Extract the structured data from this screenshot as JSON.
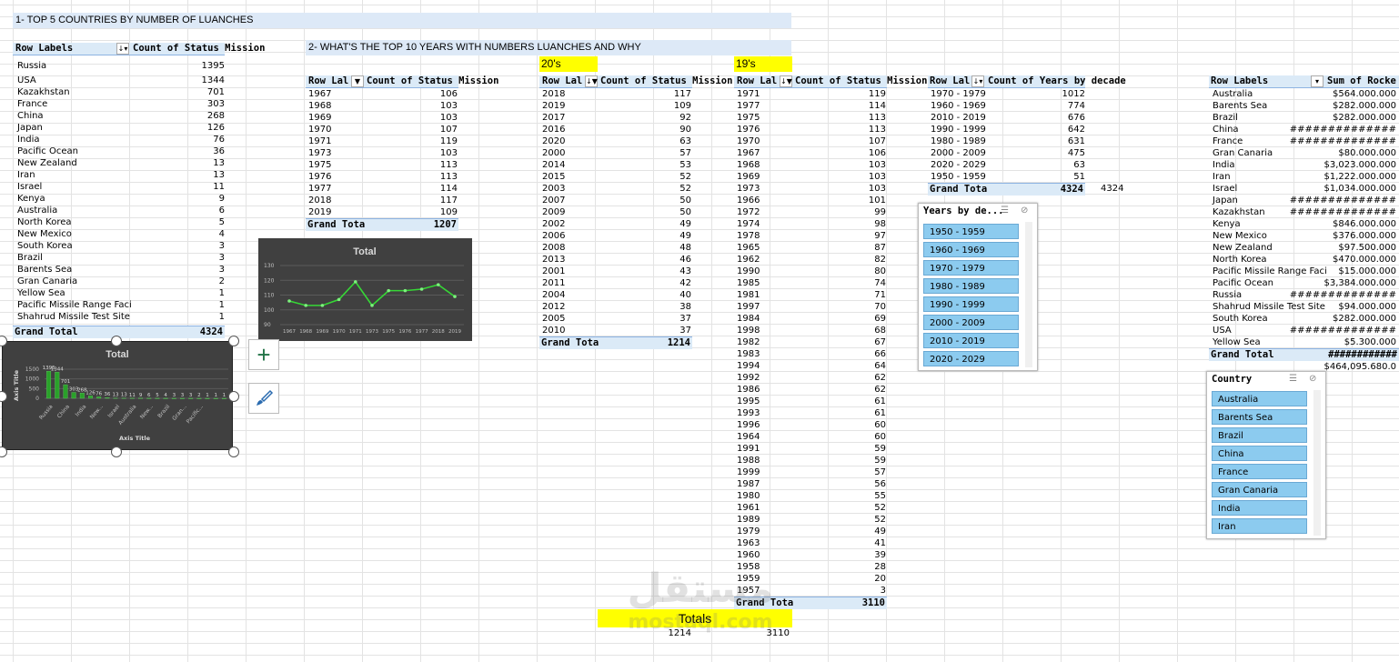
{
  "section1_title": "1- TOP 5 COUNTRIES BY NUMBER OF LUANCHES",
  "section2_title": "2- WHAT'S THE TOP 10 YEARS WITH NUMBERS LUANCHES AND WHY",
  "pt_countries": {
    "h1": "Row Labels",
    "h2": "Count of Status Mission",
    "rows": [
      [
        "Russia",
        "1395"
      ],
      [
        "USA",
        "1344"
      ],
      [
        "Kazakhstan",
        "701"
      ],
      [
        "France",
        "303"
      ],
      [
        "China",
        "268"
      ],
      [
        "Japan",
        "126"
      ],
      [
        "India",
        "76"
      ],
      [
        "Pacific Ocean",
        "36"
      ],
      [
        "New Zealand",
        "13"
      ],
      [
        "Iran",
        "13"
      ],
      [
        "Israel",
        "11"
      ],
      [
        "Kenya",
        "9"
      ],
      [
        "Australia",
        "6"
      ],
      [
        "North Korea",
        "5"
      ],
      [
        "New Mexico",
        "4"
      ],
      [
        "South Korea",
        "3"
      ],
      [
        "Brazil",
        "3"
      ],
      [
        "Barents Sea",
        "3"
      ],
      [
        "Gran Canaria",
        "2"
      ],
      [
        "Yellow Sea",
        "1"
      ],
      [
        "Pacific Missile Range Faci",
        "1"
      ],
      [
        "Shahrud Missile Test Site",
        "1"
      ]
    ],
    "total_label": "Grand Total",
    "total": "4324"
  },
  "pt_years10": {
    "h1": "Row Lal",
    "h2": "Count of Status Mission",
    "rows": [
      [
        "1967",
        "106"
      ],
      [
        "1968",
        "103"
      ],
      [
        "1969",
        "103"
      ],
      [
        "1970",
        "107"
      ],
      [
        "1971",
        "119"
      ],
      [
        "1973",
        "103"
      ],
      [
        "1975",
        "113"
      ],
      [
        "1976",
        "113"
      ],
      [
        "1977",
        "114"
      ],
      [
        "2018",
        "117"
      ],
      [
        "2019",
        "109"
      ]
    ],
    "total_label": "Grand Tota",
    "total": "1207"
  },
  "label_20s": "20's",
  "label_19s": "19's",
  "pt_20s": {
    "h1": "Row Lal",
    "h2": "Count of Status Mission",
    "rows": [
      [
        "2018",
        "117"
      ],
      [
        "2019",
        "109"
      ],
      [
        "2017",
        "92"
      ],
      [
        "2016",
        "90"
      ],
      [
        "2020",
        "63"
      ],
      [
        "2000",
        "57"
      ],
      [
        "2014",
        "53"
      ],
      [
        "2015",
        "52"
      ],
      [
        "2003",
        "52"
      ],
      [
        "2007",
        "50"
      ],
      [
        "2009",
        "50"
      ],
      [
        "2002",
        "49"
      ],
      [
        "2006",
        "49"
      ],
      [
        "2008",
        "48"
      ],
      [
        "2013",
        "46"
      ],
      [
        "2001",
        "43"
      ],
      [
        "2011",
        "42"
      ],
      [
        "2004",
        "40"
      ],
      [
        "2012",
        "38"
      ],
      [
        "2005",
        "37"
      ],
      [
        "2010",
        "37"
      ]
    ],
    "total_label": "Grand Tota",
    "total": "1214"
  },
  "pt_19s": {
    "h1": "Row Lal",
    "h2": "Count of Status Mission",
    "rows": [
      [
        "1971",
        "119"
      ],
      [
        "1977",
        "114"
      ],
      [
        "1975",
        "113"
      ],
      [
        "1976",
        "113"
      ],
      [
        "1970",
        "107"
      ],
      [
        "1967",
        "106"
      ],
      [
        "1968",
        "103"
      ],
      [
        "1969",
        "103"
      ],
      [
        "1973",
        "103"
      ],
      [
        "1966",
        "101"
      ],
      [
        "1972",
        "99"
      ],
      [
        "1974",
        "98"
      ],
      [
        "1978",
        "97"
      ],
      [
        "1965",
        "87"
      ],
      [
        "1962",
        "82"
      ],
      [
        "1990",
        "80"
      ],
      [
        "1985",
        "74"
      ],
      [
        "1981",
        "71"
      ],
      [
        "1997",
        "70"
      ],
      [
        "1984",
        "69"
      ],
      [
        "1998",
        "68"
      ],
      [
        "1982",
        "67"
      ],
      [
        "1983",
        "66"
      ],
      [
        "1994",
        "64"
      ],
      [
        "1992",
        "62"
      ],
      [
        "1986",
        "62"
      ],
      [
        "1995",
        "61"
      ],
      [
        "1993",
        "61"
      ],
      [
        "1996",
        "60"
      ],
      [
        "1964",
        "60"
      ],
      [
        "1991",
        "59"
      ],
      [
        "1988",
        "59"
      ],
      [
        "1999",
        "57"
      ],
      [
        "1987",
        "56"
      ],
      [
        "1980",
        "55"
      ],
      [
        "1961",
        "52"
      ],
      [
        "1989",
        "52"
      ],
      [
        "1979",
        "49"
      ],
      [
        "1963",
        "41"
      ],
      [
        "1960",
        "39"
      ],
      [
        "1958",
        "28"
      ],
      [
        "1959",
        "20"
      ],
      [
        "1957",
        "3"
      ]
    ],
    "total_label": "Grand Tota",
    "total": "3110"
  },
  "pt_decades": {
    "h1": "Row Lal",
    "h2": "Count of Years by decade",
    "rows": [
      [
        "1970 - 1979",
        "1012"
      ],
      [
        "1960 - 1969",
        "774"
      ],
      [
        "2010 - 2019",
        "676"
      ],
      [
        "1990 - 1999",
        "642"
      ],
      [
        "1980 - 1989",
        "631"
      ],
      [
        "2000 - 2009",
        "475"
      ],
      [
        "2020 - 2029",
        "63"
      ],
      [
        "1950 - 1959",
        "51"
      ]
    ],
    "total_label": "Grand Tota",
    "total": "4324",
    "outside_value": "4324"
  },
  "slicer_years": {
    "title": "Years by de...",
    "items": [
      "1950 - 1959",
      "1960 - 1969",
      "1970 - 1979",
      "1980 - 1989",
      "1990 - 1999",
      "2000 - 2009",
      "2010 - 2019",
      "2020 - 2029"
    ]
  },
  "pt_cost": {
    "h1": "Row Labels",
    "h2": "Sum of Rocke",
    "rows": [
      [
        "Australia",
        "$564.000.000"
      ],
      [
        "Barents Sea",
        "$282.000.000"
      ],
      [
        "Brazil",
        "$282.000.000"
      ],
      [
        "China",
        "##############"
      ],
      [
        "France",
        "##############"
      ],
      [
        "Gran Canaria",
        "$80.000.000"
      ],
      [
        "India",
        "$3,023.000.000"
      ],
      [
        "Iran",
        "$1,222.000.000"
      ],
      [
        "Israel",
        "$1,034.000.000"
      ],
      [
        "Japan",
        "##############"
      ],
      [
        "Kazakhstan",
        "##############"
      ],
      [
        "Kenya",
        "$846.000.000"
      ],
      [
        "New Mexico",
        "$376.000.000"
      ],
      [
        "New Zealand",
        "$97.500.000"
      ],
      [
        "North Korea",
        "$470.000.000"
      ],
      [
        "Pacific Missile Range Faci",
        "$15.000.000"
      ],
      [
        "Pacific Ocean",
        "$3,384.000.000"
      ],
      [
        "Russia",
        "##############"
      ],
      [
        "Shahrud Missile Test Site",
        "$94.000.000"
      ],
      [
        "South Korea",
        "$282.000.000"
      ],
      [
        "USA",
        "##############"
      ],
      [
        "Yellow Sea",
        "$5.300.000"
      ]
    ],
    "total_label": "Grand Total",
    "total": "############",
    "outside_value": "$464,095.680.0"
  },
  "slicer_country": {
    "title": "Country",
    "items": [
      "Australia",
      "Barents Sea",
      "Brazil",
      "China",
      "France",
      "Gran Canaria",
      "India",
      "Iran"
    ]
  },
  "totals_box": {
    "label": "Totals",
    "v1": "1214",
    "v2": "3110"
  },
  "chart_data": [
    {
      "type": "line",
      "title": "Total",
      "categories": [
        "1967",
        "1968",
        "1969",
        "1970",
        "1971",
        "1973",
        "1975",
        "1976",
        "1977",
        "2018",
        "2019"
      ],
      "values": [
        106,
        103,
        103,
        107,
        119,
        103,
        113,
        113,
        114,
        117,
        109
      ],
      "ylim": [
        90,
        130
      ],
      "yticks": [
        "130",
        "120",
        "110",
        "100",
        "90"
      ],
      "grid": true
    },
    {
      "type": "bar",
      "title": "Total",
      "xlabel": "Axis Title",
      "ylabel": "Axis Title",
      "categories": [
        "Russia",
        "USA",
        "Kazakhstan",
        "France",
        "China",
        "Japan",
        "India",
        "Pacific Ocean",
        "New Zealand",
        "Iran",
        "Israel",
        "Kenya",
        "Australia",
        "North Korea",
        "New Mexico",
        "South Korea",
        "Brazil",
        "Barents Sea",
        "Gran Canaria",
        "Yellow Sea",
        "Pacific Missile Range Faci",
        "Shahrud Missile Test Site"
      ],
      "tick_labels": [
        "Russia",
        "China",
        "India",
        "New...",
        "Israel",
        "Australia",
        "New...",
        "Brazil",
        "Gran...",
        "Pacific..."
      ],
      "values": [
        1395,
        1344,
        701,
        303,
        268,
        126,
        76,
        36,
        13,
        13,
        11,
        9,
        6,
        5,
        4,
        3,
        3,
        3,
        2,
        1,
        1,
        1
      ],
      "data_labels": [
        "1395",
        "1344",
        "701",
        "303",
        "268",
        "126",
        "76",
        "36",
        "13",
        "13",
        "11",
        "9",
        "6",
        "5",
        "4",
        "3",
        "3",
        "3",
        "2",
        "1",
        "1",
        "1"
      ],
      "ylim": [
        0,
        1500
      ],
      "yticks": [
        "1500",
        "1000",
        "500",
        "0"
      ],
      "grid": true
    }
  ],
  "watermark": {
    "line1": "مستقل",
    "line2": "mostaql.com"
  }
}
